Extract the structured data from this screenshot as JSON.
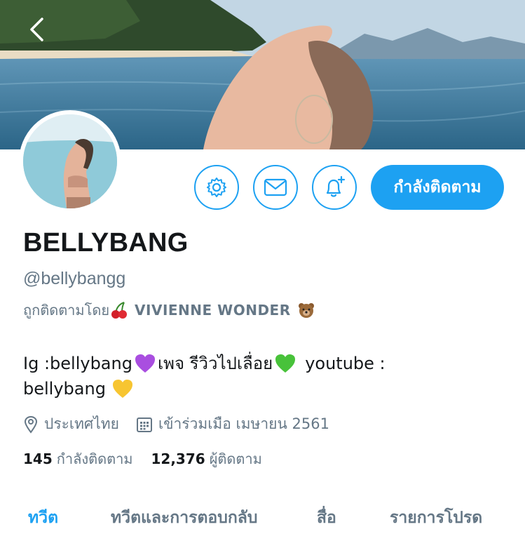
{
  "profile": {
    "display_name": "BELLYBANG",
    "handle": "@bellybangg",
    "followed_by_prefix": "ถูกติดตามโดย",
    "followed_by_name": "VIVIENNE WONDER",
    "bio_line1_a": "Ig :bellybang",
    "bio_line1_b": "เพจ รีวิวไปเลื่อย",
    "bio_line1_c": "youtube :",
    "bio_line2": "bellybang",
    "location": "ประเทศไทย",
    "joined": "เข้าร่วมเมือ เมษายน 2561",
    "following_count": "145",
    "following_label": "กำลังติดตาม",
    "followers_count": "12,376",
    "followers_label": "ผู้ติดตาม"
  },
  "actions": {
    "follow_label": "กำลังติดตาม"
  },
  "tabs": [
    {
      "label": "ทวีต",
      "active": true
    },
    {
      "label": "ทวีตและการตอบกลับ",
      "active": false
    },
    {
      "label": "สื่อ",
      "active": false
    },
    {
      "label": "รายการโปรด",
      "active": false
    }
  ],
  "icons": {
    "back": "chevron-left-icon",
    "settings": "gear-icon",
    "message": "envelope-icon",
    "notify": "bell-plus-icon",
    "location": "location-pin-icon",
    "calendar": "calendar-icon"
  },
  "colors": {
    "accent": "#1da1f2",
    "secondary_text": "#657786",
    "primary_text": "#14171a"
  }
}
